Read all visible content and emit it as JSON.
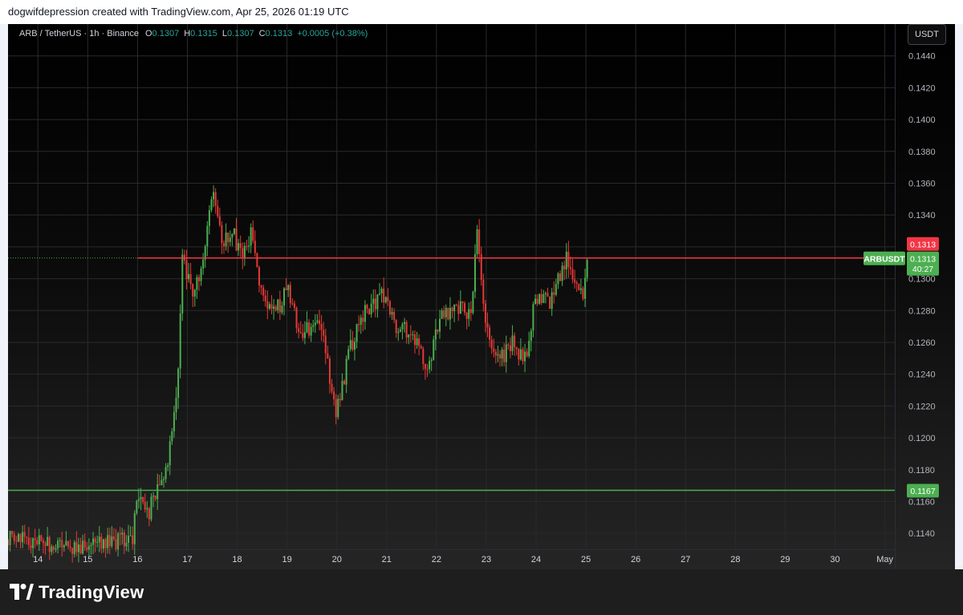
{
  "header": {
    "attribution": "dogwifdepression created with TradingView.com, Apr 25, 2026 01:19 UTC"
  },
  "legend": {
    "symbol": "ARB / TetherUS · 1h · Binance",
    "o_label": "O",
    "o_value": "0.1307",
    "h_label": "H",
    "h_value": "0.1315",
    "l_label": "L",
    "l_value": "0.1307",
    "c_label": "C",
    "c_value": "0.1313",
    "change": "+0.0005 (+0.38%)"
  },
  "currency_button": "USDT",
  "footer": {
    "brand": "TradingView"
  },
  "colors": {
    "up": "#26a69a",
    "down": "#ef5350",
    "candle_up": "#4caf50",
    "candle_down": "#e53935",
    "support": "#4caf50",
    "resistance": "#f23645"
  },
  "chart_data": {
    "type": "candlestick",
    "title": "ARB / TetherUS · 1h · Binance",
    "ylim": [
      0.113,
      0.146
    ],
    "y_ticks": [
      "0.1440",
      "0.1420",
      "0.1400",
      "0.1380",
      "0.1360",
      "0.1340",
      "0.1320",
      "0.1300",
      "0.1280",
      "0.1260",
      "0.1240",
      "0.1220",
      "0.1200",
      "0.1180",
      "0.1160",
      "0.1140"
    ],
    "x_ticks": [
      "14",
      "15",
      "16",
      "17",
      "18",
      "19",
      "20",
      "21",
      "22",
      "23",
      "24",
      "25",
      "26",
      "27",
      "28",
      "29",
      "30",
      "May"
    ],
    "x_range_days": [
      13.4,
      31.2
    ],
    "grid": true,
    "horizontal_lines": [
      {
        "name": "resistance",
        "value": 0.1313,
        "label": "0.1313",
        "start_day": 16.0
      },
      {
        "name": "support",
        "value": 0.1167,
        "label": "0.1167",
        "start_day": 13.4
      }
    ],
    "last_price": {
      "symbol": "ARBUSDT",
      "value": "0.1313",
      "countdown": "40:27"
    },
    "path_points": [
      [
        13.4,
        0.1136
      ],
      [
        14.0,
        0.1134
      ],
      [
        14.5,
        0.1133
      ],
      [
        15.2,
        0.1132
      ],
      [
        15.5,
        0.1134
      ],
      [
        15.9,
        0.1138
      ],
      [
        16.2,
        0.115
      ],
      [
        16.0,
        0.1165
      ],
      [
        16.3,
        0.116
      ],
      [
        16.6,
        0.1185
      ],
      [
        16.8,
        0.123
      ],
      [
        16.9,
        0.132
      ],
      [
        17.1,
        0.1285
      ],
      [
        17.3,
        0.131
      ],
      [
        17.5,
        0.1355
      ],
      [
        17.7,
        0.1325
      ],
      [
        17.9,
        0.133
      ],
      [
        18.1,
        0.131
      ],
      [
        18.3,
        0.133
      ],
      [
        18.5,
        0.129
      ],
      [
        18.8,
        0.128
      ],
      [
        19.0,
        0.1295
      ],
      [
        19.3,
        0.126
      ],
      [
        19.6,
        0.128
      ],
      [
        19.8,
        0.125
      ],
      [
        20.0,
        0.1215
      ],
      [
        20.3,
        0.126
      ],
      [
        20.6,
        0.128
      ],
      [
        20.9,
        0.129
      ],
      [
        21.2,
        0.127
      ],
      [
        21.5,
        0.1265
      ],
      [
        21.8,
        0.1245
      ],
      [
        22.1,
        0.1275
      ],
      [
        22.4,
        0.1285
      ],
      [
        22.7,
        0.1275
      ],
      [
        22.8,
        0.133
      ],
      [
        23.0,
        0.127
      ],
      [
        23.2,
        0.1245
      ],
      [
        23.5,
        0.126
      ],
      [
        23.8,
        0.125
      ],
      [
        24.0,
        0.129
      ],
      [
        24.3,
        0.1285
      ],
      [
        24.5,
        0.1305
      ],
      [
        24.6,
        0.1315
      ],
      [
        24.8,
        0.13
      ],
      [
        24.95,
        0.129
      ],
      [
        25.05,
        0.1313
      ]
    ]
  }
}
